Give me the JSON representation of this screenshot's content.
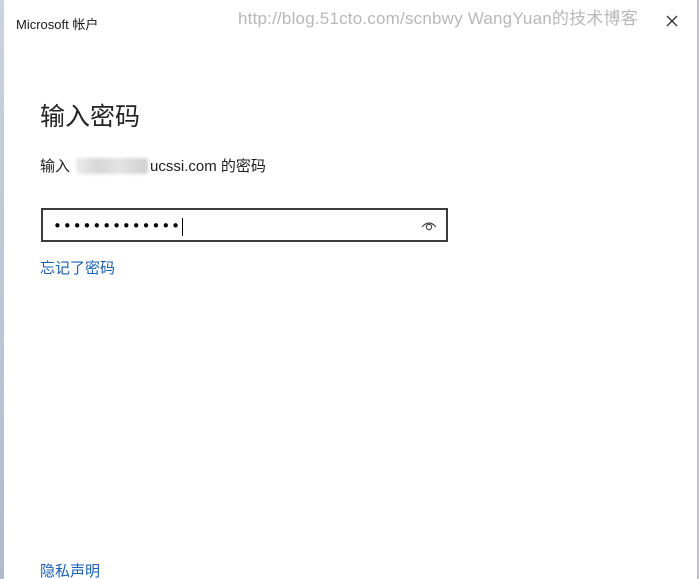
{
  "window": {
    "app_title": "Microsoft 帐户",
    "watermark": "http://blog.51cto.com/scnbwy WangYuan的技术博客"
  },
  "main": {
    "title": "输入密码",
    "prompt_prefix": "输入",
    "prompt_suffix": "ucssi.com 的密码",
    "password_mask": "•••••••••••••",
    "forgot_password_link": "忘记了密码"
  },
  "footer": {
    "privacy_link": "隐私声明"
  },
  "icons": {
    "close": "close-icon",
    "reveal": "eye-icon"
  },
  "colors": {
    "link": "#1a5fb4",
    "field_border": "#3b3b3b"
  }
}
